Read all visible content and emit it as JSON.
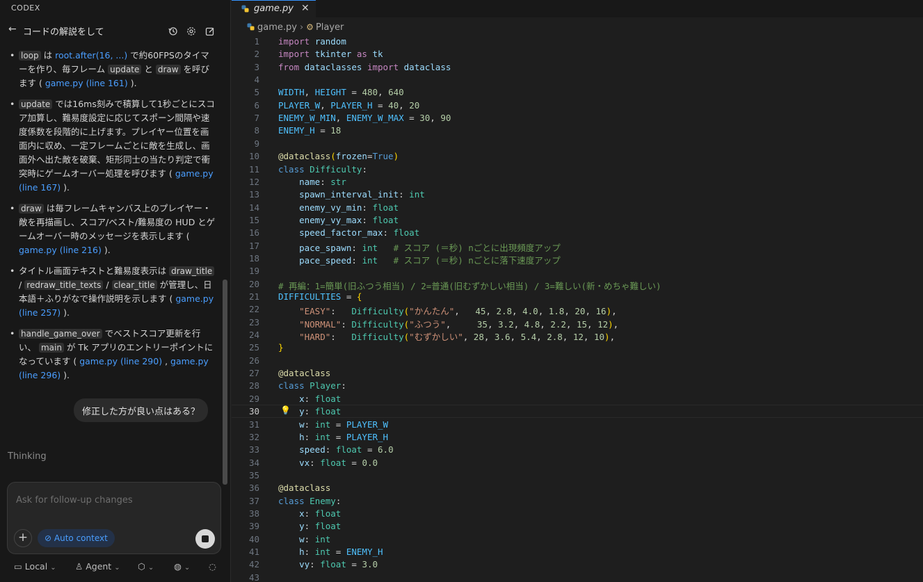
{
  "sidebar": {
    "title": "CODEX",
    "chat_title": "コードの解説をして",
    "bullets": [
      {
        "parts": [
          {
            "t": "code",
            "v": "loop"
          },
          {
            "t": "text",
            "v": " は "
          },
          {
            "t": "link",
            "v": "root.after(16, ...)"
          },
          {
            "t": "text",
            "v": " で約60FPSのタイマーを作り、毎フレーム "
          },
          {
            "t": "code",
            "v": "update"
          },
          {
            "t": "text",
            "v": " と "
          },
          {
            "t": "code",
            "v": "draw"
          },
          {
            "t": "text",
            "v": " を呼びます ( "
          },
          {
            "t": "link",
            "v": "game.py (line 161)"
          },
          {
            "t": "text",
            "v": " )."
          }
        ]
      },
      {
        "parts": [
          {
            "t": "code",
            "v": "update"
          },
          {
            "t": "text",
            "v": " では16ms刻みで積算して1秒ごとにスコア加算し、難易度設定に応じてスポーン間隔や速度係数を段階的に上げます。プレイヤー位置を画面内に収め、一定フレームごとに敵を生成し、画面外へ出た敵を破棄、矩形同士の当たり判定で衝突時にゲームオーバー処理を呼びます ( "
          },
          {
            "t": "link",
            "v": "game.py (line 167)"
          },
          {
            "t": "text",
            "v": " )."
          }
        ]
      },
      {
        "parts": [
          {
            "t": "code",
            "v": "draw"
          },
          {
            "t": "text",
            "v": " は毎フレームキャンバス上のプレイヤー・敵を再描画し、スコア/ベスト/難易度の HUD とゲームオーバー時のメッセージを表示します ( "
          },
          {
            "t": "link",
            "v": "game.py (line 216)"
          },
          {
            "t": "text",
            "v": " )."
          }
        ]
      },
      {
        "parts": [
          {
            "t": "text",
            "v": "タイトル画面テキストと難易度表示は "
          },
          {
            "t": "code",
            "v": "draw_title"
          },
          {
            "t": "text",
            "v": " / "
          },
          {
            "t": "code",
            "v": "redraw_title_texts"
          },
          {
            "t": "text",
            "v": " / "
          },
          {
            "t": "code",
            "v": "clear_title"
          },
          {
            "t": "text",
            "v": " が管理し、日本語＋ふりがなで操作説明を示します ( "
          },
          {
            "t": "link",
            "v": "game.py (line 257)"
          },
          {
            "t": "text",
            "v": " )."
          }
        ]
      },
      {
        "parts": [
          {
            "t": "code",
            "v": "handle_game_over"
          },
          {
            "t": "text",
            "v": " でベストスコア更新を行い、 "
          },
          {
            "t": "code",
            "v": "main"
          },
          {
            "t": "text",
            "v": " が Tk アプリのエントリーポイントになっています ( "
          },
          {
            "t": "link",
            "v": "game.py (line 290)"
          },
          {
            "t": "text",
            "v": " , "
          },
          {
            "t": "link",
            "v": "game.py (line 296)"
          },
          {
            "t": "text",
            "v": " )."
          }
        ]
      }
    ],
    "user_message": "修正した方が良い点はある？",
    "thinking": "Thinking",
    "composer": {
      "placeholder": "Ask for follow-up changes",
      "auto_context": "Auto context"
    },
    "bottom_bar": {
      "local": "Local",
      "agent": "Agent"
    }
  },
  "editor": {
    "tab_label": "game.py",
    "breadcrumb_file": "game.py",
    "breadcrumb_symbol": "Player",
    "current_line": 30,
    "lines": [
      [
        [
          "k",
          "import"
        ],
        [
          "p",
          " "
        ],
        [
          "v",
          "random"
        ]
      ],
      [
        [
          "k",
          "import"
        ],
        [
          "p",
          " "
        ],
        [
          "v",
          "tkinter"
        ],
        [
          "p",
          " "
        ],
        [
          "k",
          "as"
        ],
        [
          "p",
          " "
        ],
        [
          "v",
          "tk"
        ]
      ],
      [
        [
          "k",
          "from"
        ],
        [
          "p",
          " "
        ],
        [
          "v",
          "dataclasses"
        ],
        [
          "p",
          " "
        ],
        [
          "k",
          "import"
        ],
        [
          "p",
          " "
        ],
        [
          "v",
          "dataclass"
        ]
      ],
      [],
      [
        [
          "c",
          "WIDTH"
        ],
        [
          "p",
          ", "
        ],
        [
          "c",
          "HEIGHT"
        ],
        [
          "p",
          " = "
        ],
        [
          "n",
          "480"
        ],
        [
          "p",
          ", "
        ],
        [
          "n",
          "640"
        ]
      ],
      [
        [
          "c",
          "PLAYER_W"
        ],
        [
          "p",
          ", "
        ],
        [
          "c",
          "PLAYER_H"
        ],
        [
          "p",
          " = "
        ],
        [
          "n",
          "40"
        ],
        [
          "p",
          ", "
        ],
        [
          "n",
          "20"
        ]
      ],
      [
        [
          "c",
          "ENEMY_W_MIN"
        ],
        [
          "p",
          ", "
        ],
        [
          "c",
          "ENEMY_W_MAX"
        ],
        [
          "p",
          " = "
        ],
        [
          "n",
          "30"
        ],
        [
          "p",
          ", "
        ],
        [
          "n",
          "90"
        ]
      ],
      [
        [
          "c",
          "ENEMY_H"
        ],
        [
          "p",
          " = "
        ],
        [
          "n",
          "18"
        ]
      ],
      [],
      [
        [
          "d",
          "@dataclass"
        ],
        [
          "br",
          "("
        ],
        [
          "v",
          "frozen"
        ],
        [
          "p",
          "="
        ],
        [
          "kb",
          "True"
        ],
        [
          "br",
          ")"
        ]
      ],
      [
        [
          "kb",
          "class"
        ],
        [
          "p",
          " "
        ],
        [
          "cls",
          "Difficulty"
        ],
        [
          "p",
          ":"
        ]
      ],
      [
        [
          "p",
          "    "
        ],
        [
          "v",
          "name"
        ],
        [
          "p",
          ": "
        ],
        [
          "cls",
          "str"
        ]
      ],
      [
        [
          "p",
          "    "
        ],
        [
          "v",
          "spawn_interval_init"
        ],
        [
          "p",
          ": "
        ],
        [
          "cls",
          "int"
        ]
      ],
      [
        [
          "p",
          "    "
        ],
        [
          "v",
          "enemy_vy_min"
        ],
        [
          "p",
          ": "
        ],
        [
          "cls",
          "float"
        ]
      ],
      [
        [
          "p",
          "    "
        ],
        [
          "v",
          "enemy_vy_max"
        ],
        [
          "p",
          ": "
        ],
        [
          "cls",
          "float"
        ]
      ],
      [
        [
          "p",
          "    "
        ],
        [
          "v",
          "speed_factor_max"
        ],
        [
          "p",
          ": "
        ],
        [
          "cls",
          "float"
        ]
      ],
      [
        [
          "p",
          "    "
        ],
        [
          "v",
          "pace_spawn"
        ],
        [
          "p",
          ": "
        ],
        [
          "cls",
          "int"
        ],
        [
          "p",
          "   "
        ],
        [
          "cm",
          "# スコア (＝秒) nごとに出現頻度アップ"
        ]
      ],
      [
        [
          "p",
          "    "
        ],
        [
          "v",
          "pace_speed"
        ],
        [
          "p",
          ": "
        ],
        [
          "cls",
          "int"
        ],
        [
          "p",
          "   "
        ],
        [
          "cm",
          "# スコア (＝秒) nごとに落下速度アップ"
        ]
      ],
      [],
      [
        [
          "cm",
          "# 再編：1=簡単(旧ふつう相当) / 2=普通(旧むずかしい相当) / 3=難しい(新・めちゃ難しい)"
        ]
      ],
      [
        [
          "c",
          "DIFFICULTIES"
        ],
        [
          "p",
          " = "
        ],
        [
          "br",
          "{"
        ]
      ],
      [
        [
          "p",
          "    "
        ],
        [
          "s",
          "\"EASY\""
        ],
        [
          "p",
          ":   "
        ],
        [
          "cls",
          "Difficulty"
        ],
        [
          "br",
          "("
        ],
        [
          "s",
          "\"かんたん\""
        ],
        [
          "p",
          ",   "
        ],
        [
          "n",
          "45"
        ],
        [
          "p",
          ", "
        ],
        [
          "n",
          "2.8"
        ],
        [
          "p",
          ", "
        ],
        [
          "n",
          "4.0"
        ],
        [
          "p",
          ", "
        ],
        [
          "n",
          "1.8"
        ],
        [
          "p",
          ", "
        ],
        [
          "n",
          "20"
        ],
        [
          "p",
          ", "
        ],
        [
          "n",
          "16"
        ],
        [
          "br",
          ")"
        ],
        [
          "p",
          ","
        ]
      ],
      [
        [
          "p",
          "    "
        ],
        [
          "s",
          "\"NORMAL\""
        ],
        [
          "p",
          ": "
        ],
        [
          "cls",
          "Difficulty"
        ],
        [
          "br",
          "("
        ],
        [
          "s",
          "\"ふつう\""
        ],
        [
          "p",
          ",     "
        ],
        [
          "n",
          "35"
        ],
        [
          "p",
          ", "
        ],
        [
          "n",
          "3.2"
        ],
        [
          "p",
          ", "
        ],
        [
          "n",
          "4.8"
        ],
        [
          "p",
          ", "
        ],
        [
          "n",
          "2.2"
        ],
        [
          "p",
          ", "
        ],
        [
          "n",
          "15"
        ],
        [
          "p",
          ", "
        ],
        [
          "n",
          "12"
        ],
        [
          "br",
          ")"
        ],
        [
          "p",
          ","
        ]
      ],
      [
        [
          "p",
          "    "
        ],
        [
          "s",
          "\"HARD\""
        ],
        [
          "p",
          ":   "
        ],
        [
          "cls",
          "Difficulty"
        ],
        [
          "br",
          "("
        ],
        [
          "s",
          "\"むずかしい\""
        ],
        [
          "p",
          ", "
        ],
        [
          "n",
          "28"
        ],
        [
          "p",
          ", "
        ],
        [
          "n",
          "3.6"
        ],
        [
          "p",
          ", "
        ],
        [
          "n",
          "5.4"
        ],
        [
          "p",
          ", "
        ],
        [
          "n",
          "2.8"
        ],
        [
          "p",
          ", "
        ],
        [
          "n",
          "12"
        ],
        [
          "p",
          ", "
        ],
        [
          "n",
          "10"
        ],
        [
          "br",
          ")"
        ],
        [
          "p",
          ","
        ]
      ],
      [
        [
          "br",
          "}"
        ]
      ],
      [],
      [
        [
          "d",
          "@dataclass"
        ]
      ],
      [
        [
          "kb",
          "class"
        ],
        [
          "p",
          " "
        ],
        [
          "cls",
          "Player"
        ],
        [
          "p",
          ":"
        ]
      ],
      [
        [
          "p",
          "    "
        ],
        [
          "v",
          "x"
        ],
        [
          "p",
          ": "
        ],
        [
          "cls",
          "float"
        ]
      ],
      [
        [
          "p",
          "    "
        ],
        [
          "v",
          "y"
        ],
        [
          "p",
          ": "
        ],
        [
          "cls",
          "float"
        ]
      ],
      [
        [
          "p",
          "    "
        ],
        [
          "v",
          "w"
        ],
        [
          "p",
          ": "
        ],
        [
          "cls",
          "int"
        ],
        [
          "p",
          " = "
        ],
        [
          "c",
          "PLAYER_W"
        ]
      ],
      [
        [
          "p",
          "    "
        ],
        [
          "v",
          "h"
        ],
        [
          "p",
          ": "
        ],
        [
          "cls",
          "int"
        ],
        [
          "p",
          " = "
        ],
        [
          "c",
          "PLAYER_H"
        ]
      ],
      [
        [
          "p",
          "    "
        ],
        [
          "v",
          "speed"
        ],
        [
          "p",
          ": "
        ],
        [
          "cls",
          "float"
        ],
        [
          "p",
          " = "
        ],
        [
          "n",
          "6.0"
        ]
      ],
      [
        [
          "p",
          "    "
        ],
        [
          "v",
          "vx"
        ],
        [
          "p",
          ": "
        ],
        [
          "cls",
          "float"
        ],
        [
          "p",
          " = "
        ],
        [
          "n",
          "0.0"
        ]
      ],
      [],
      [
        [
          "d",
          "@dataclass"
        ]
      ],
      [
        [
          "kb",
          "class"
        ],
        [
          "p",
          " "
        ],
        [
          "cls",
          "Enemy"
        ],
        [
          "p",
          ":"
        ]
      ],
      [
        [
          "p",
          "    "
        ],
        [
          "v",
          "x"
        ],
        [
          "p",
          ": "
        ],
        [
          "cls",
          "float"
        ]
      ],
      [
        [
          "p",
          "    "
        ],
        [
          "v",
          "y"
        ],
        [
          "p",
          ": "
        ],
        [
          "cls",
          "float"
        ]
      ],
      [
        [
          "p",
          "    "
        ],
        [
          "v",
          "w"
        ],
        [
          "p",
          ": "
        ],
        [
          "cls",
          "int"
        ]
      ],
      [
        [
          "p",
          "    "
        ],
        [
          "v",
          "h"
        ],
        [
          "p",
          ": "
        ],
        [
          "cls",
          "int"
        ],
        [
          "p",
          " = "
        ],
        [
          "c",
          "ENEMY_H"
        ]
      ],
      [
        [
          "p",
          "    "
        ],
        [
          "v",
          "vy"
        ],
        [
          "p",
          ": "
        ],
        [
          "cls",
          "float"
        ],
        [
          "p",
          " = "
        ],
        [
          "n",
          "3.0"
        ]
      ],
      []
    ]
  }
}
